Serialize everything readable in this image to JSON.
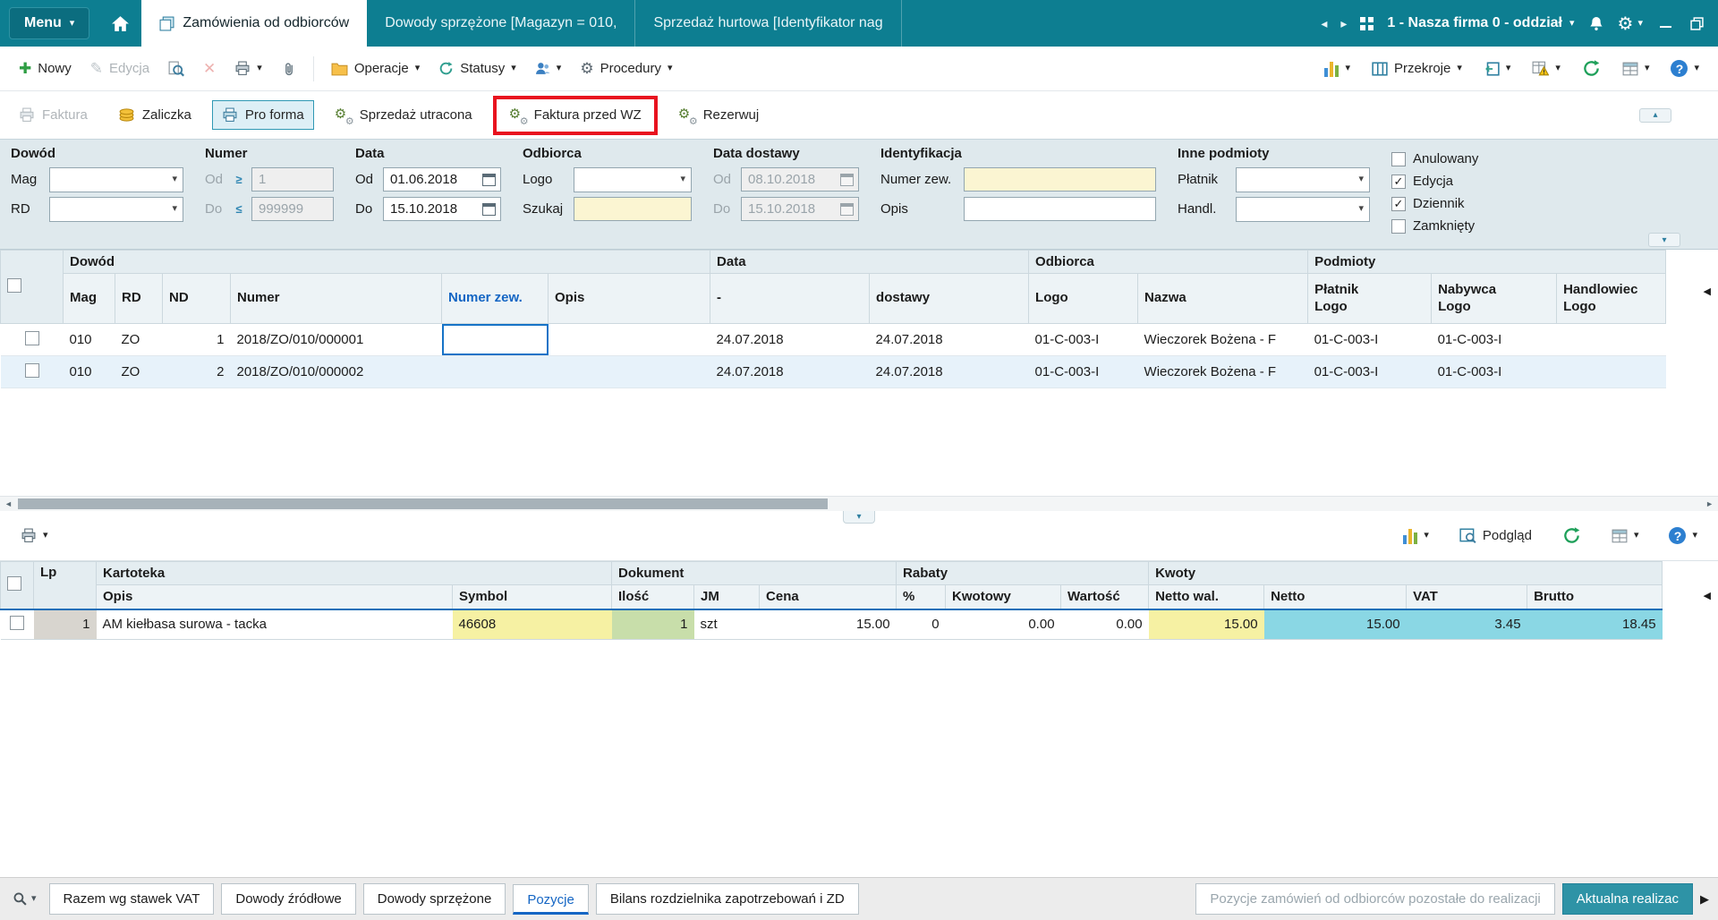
{
  "colors": {
    "topbar_teal": "#0d7e91",
    "selection_blue": "#1673c7",
    "annotation_red": "#e8131f",
    "input_yellow": "#fbf5d2",
    "cell_yellow": "#f6f1a3",
    "cell_green": "#c8deaa",
    "cell_cyan": "#8ad7e4",
    "link_blue": "#1566c4"
  },
  "topbar": {
    "menu_label": "Menu",
    "tabs": [
      {
        "label": "Zamówienia od odbiorców",
        "active": true
      },
      {
        "label": "Dowody sprzężone [Magazyn = 010,",
        "active": false
      },
      {
        "label": "Sprzedaż hurtowa [Identyfikator nag",
        "active": false
      }
    ],
    "company_selector": "1 - Nasza firma 0 - oddział"
  },
  "toolbar": {
    "nowy": "Nowy",
    "edycja": "Edycja",
    "operacje": "Operacje",
    "statusy": "Statusy",
    "procedury": "Procedury",
    "przekroje": "Przekroje"
  },
  "actions": {
    "faktura": "Faktura",
    "zaliczka": "Zaliczka",
    "pro_forma": "Pro forma",
    "sprzedaz_utracona": "Sprzedaż utracona",
    "faktura_przed_wz": "Faktura przed WZ",
    "rezerwuj": "Rezerwuj"
  },
  "filters": {
    "dowod": {
      "title": "Dowód",
      "row1_label": "Mag",
      "row2_label": "RD"
    },
    "numer": {
      "title": "Numer",
      "od_label": "Od",
      "od_value": "1",
      "do_label": "Do",
      "do_value": "999999",
      "ge": "≥",
      "le": "≤"
    },
    "data": {
      "title": "Data",
      "od_label": "Od",
      "od_value": "01.06.2018",
      "do_label": "Do",
      "do_value": "15.10.2018"
    },
    "odbiorca": {
      "title": "Odbiorca",
      "row1_label": "Logo",
      "row2_label": "Szukaj"
    },
    "data_dostawy": {
      "title": "Data dostawy",
      "od_label": "Od",
      "od_value": "08.10.2018",
      "do_label": "Do",
      "do_value": "15.10.2018"
    },
    "identyfikacja": {
      "title": "Identyfikacja",
      "row1_label": "Numer zew.",
      "row2_label": "Opis"
    },
    "inne_podmioty": {
      "title": "Inne podmioty",
      "row1_label": "Płatnik",
      "row2_label": "Handl."
    },
    "checkboxes": [
      {
        "label": "Anulowany",
        "checked": false
      },
      {
        "label": "Edycja",
        "checked": true
      },
      {
        "label": "Dziennik",
        "checked": true
      },
      {
        "label": "Zamknięty",
        "checked": false
      }
    ]
  },
  "orders_grid": {
    "groups": {
      "dowod": "Dowód",
      "data": "Data",
      "odbiorca": "Odbiorca",
      "podmioty": "Podmioty"
    },
    "columns": [
      {
        "l1": "Mag"
      },
      {
        "l1": "RD"
      },
      {
        "l1": "ND"
      },
      {
        "l1": "Numer"
      },
      {
        "l1": "Numer zew."
      },
      {
        "l1": "Opis"
      },
      {
        "l1": "-"
      },
      {
        "l1": "dostawy"
      },
      {
        "l1": "Logo"
      },
      {
        "l1": "Nazwa"
      },
      {
        "l1": "Płatnik",
        "l2": "Logo"
      },
      {
        "l1": "Nabywca",
        "l2": "Logo"
      },
      {
        "l1": "Handlowiec",
        "l2": "Logo"
      }
    ],
    "rows": [
      [
        "010",
        "ZO",
        "1",
        "2018/ZO/010/000001",
        "",
        "",
        "24.07.2018",
        "24.07.2018",
        "01-C-003-I",
        "Wieczorek Bożena - F",
        "01-C-003-I",
        "01-C-003-I",
        ""
      ],
      [
        "010",
        "ZO",
        "2",
        "2018/ZO/010/000002",
        "",
        "",
        "24.07.2018",
        "24.07.2018",
        "01-C-003-I",
        "Wieczorek Bożena - F",
        "01-C-003-I",
        "01-C-003-I",
        ""
      ]
    ]
  },
  "preview_toolbar": {
    "podglad": "Podgląd"
  },
  "positions_grid": {
    "groups": {
      "lp": "Lp",
      "kartoteka": "Kartoteka",
      "dokument": "Dokument",
      "rabaty": "Rabaty",
      "kwoty": "Kwoty"
    },
    "columns": [
      "Opis",
      "Symbol",
      "Ilość",
      "JM",
      "Cena",
      "%",
      "Kwotowy",
      "Wartość",
      "Netto wal.",
      "Netto",
      "VAT",
      "Brutto"
    ],
    "rows": [
      [
        "1",
        "AM kiełbasa surowa - tacka",
        "46608",
        "1",
        "szt",
        "15.00",
        "0",
        "0.00",
        "0.00",
        "15.00",
        "15.00",
        "3.45",
        "18.45"
      ]
    ]
  },
  "bottom_tabs": [
    {
      "label": "Razem wg stawek VAT",
      "state": "normal"
    },
    {
      "label": "Dowody źródłowe",
      "state": "normal"
    },
    {
      "label": "Dowody sprzężone",
      "state": "normal"
    },
    {
      "label": "Pozycje",
      "state": "active"
    },
    {
      "label": "Bilans rozdzielnika zapotrzebowań i ZD",
      "state": "normal"
    },
    {
      "label": "Pozycje zamówień od odbiorców pozostałe do realizacji",
      "state": "disabled"
    },
    {
      "label": "Aktualna realizac",
      "state": "highlight"
    }
  ]
}
